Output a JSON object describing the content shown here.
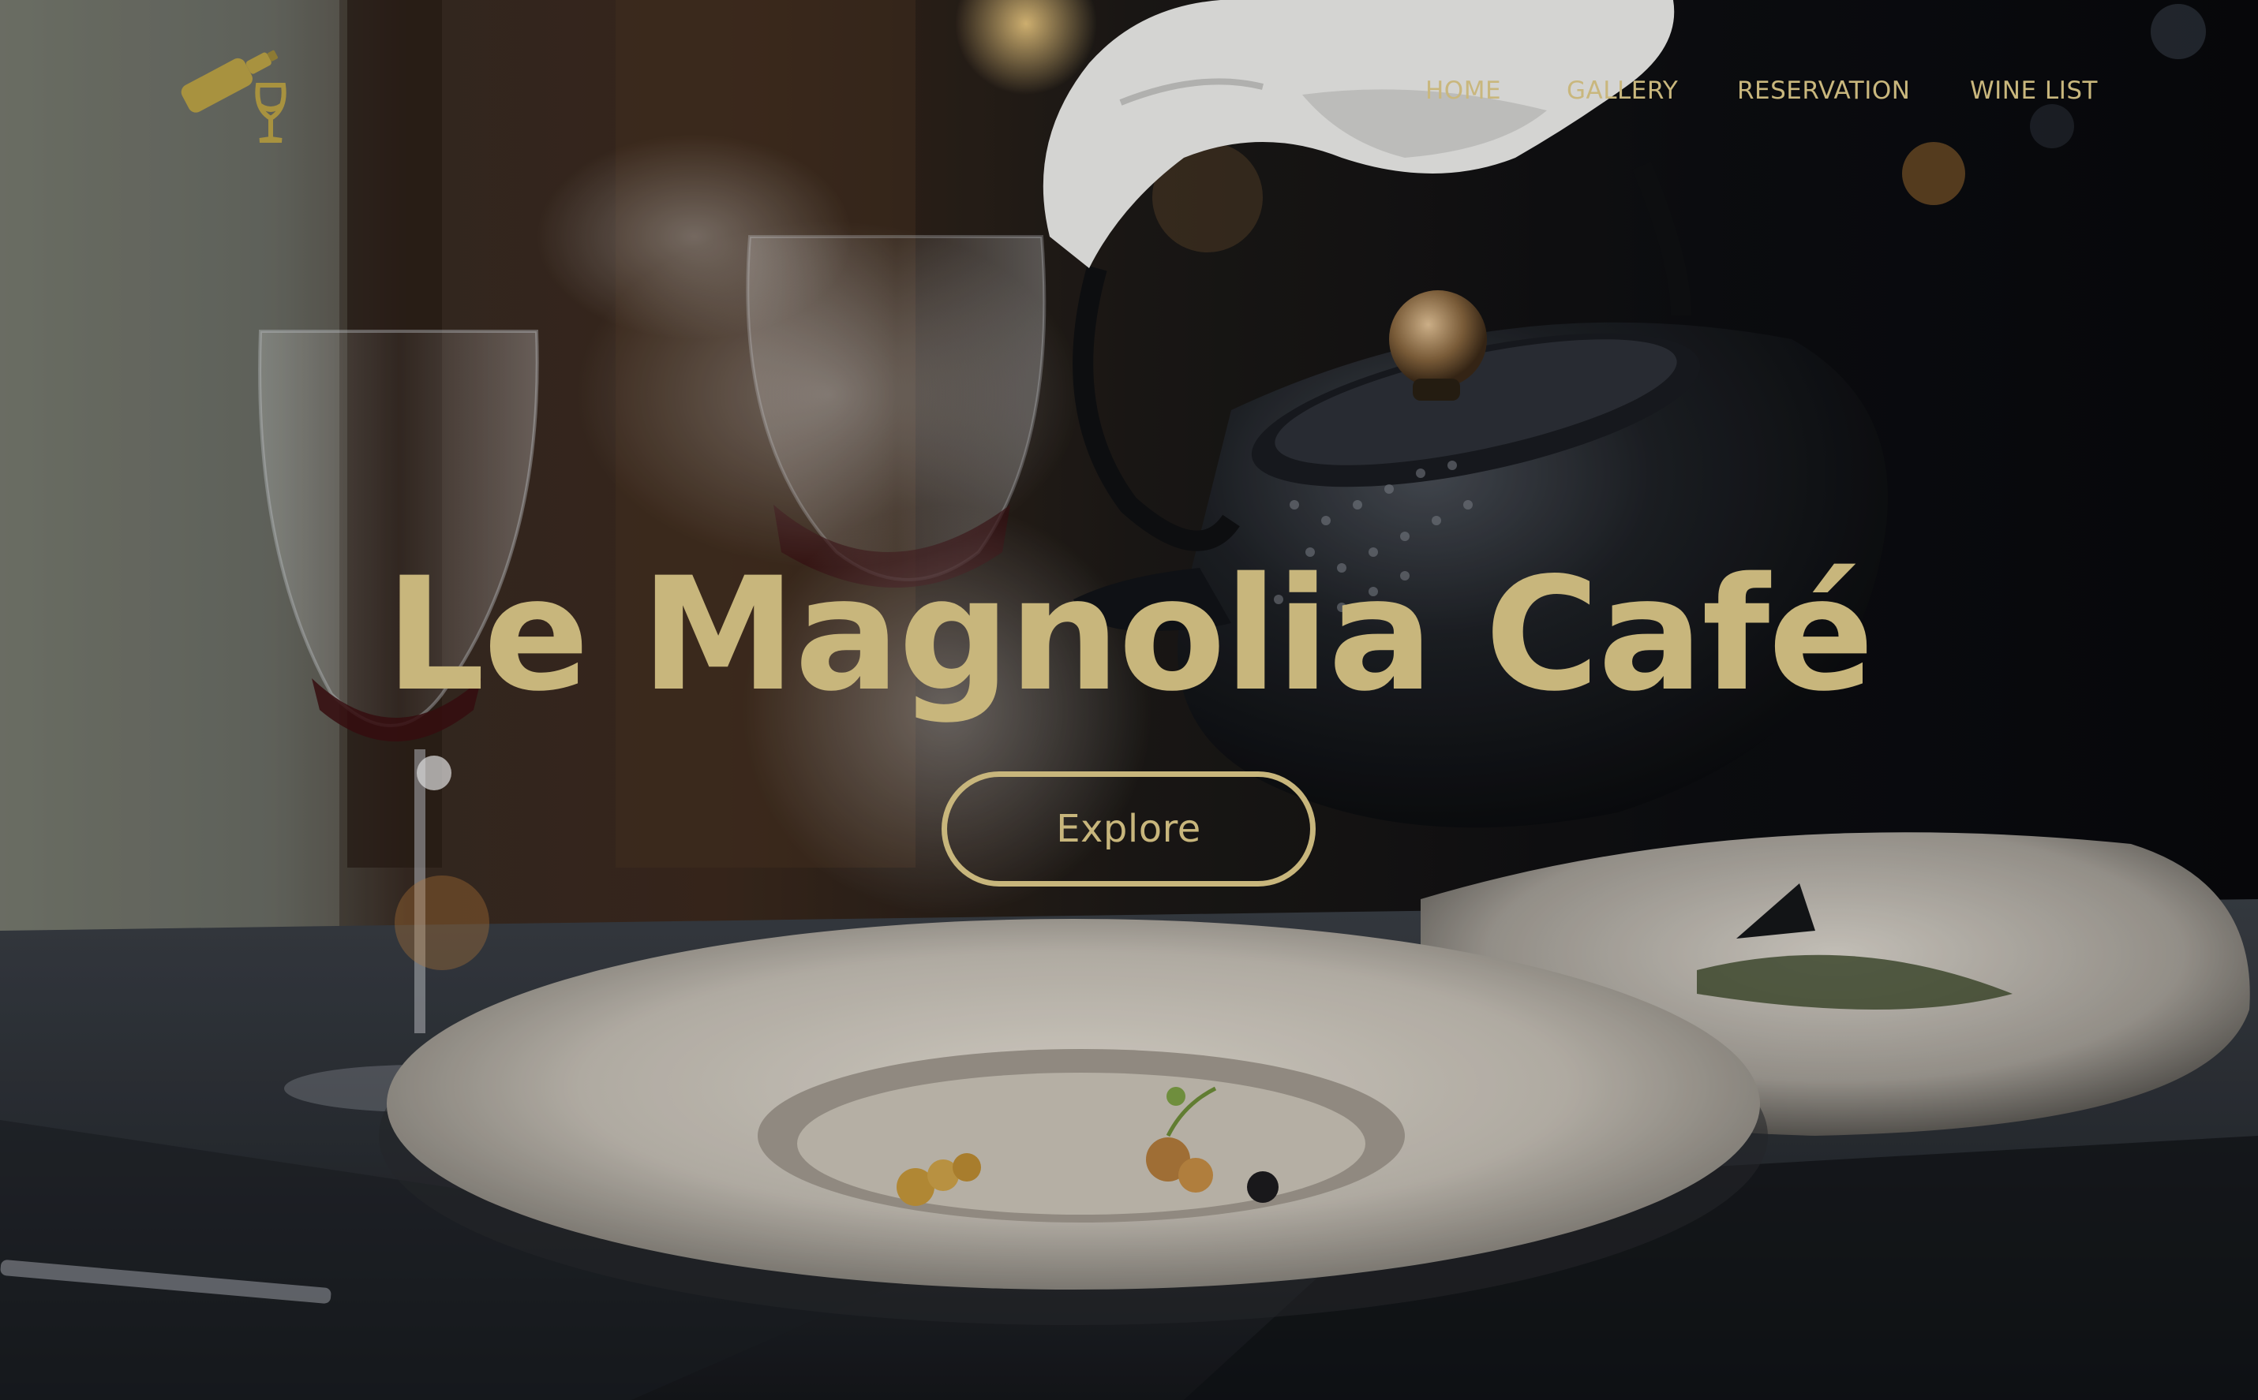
{
  "nav": {
    "items": [
      {
        "label": "HOME"
      },
      {
        "label": "GALLERY"
      },
      {
        "label": "RESERVATION"
      },
      {
        "label": "WINE LIST"
      }
    ]
  },
  "hero": {
    "title": "Le Magnolia Café",
    "explore_label": "Explore"
  },
  "colors": {
    "accent_gold": "#c8b67c",
    "background_dark": "#0c0d10"
  },
  "icons": {
    "logo": "wine-bottle-and-glass-logo"
  }
}
